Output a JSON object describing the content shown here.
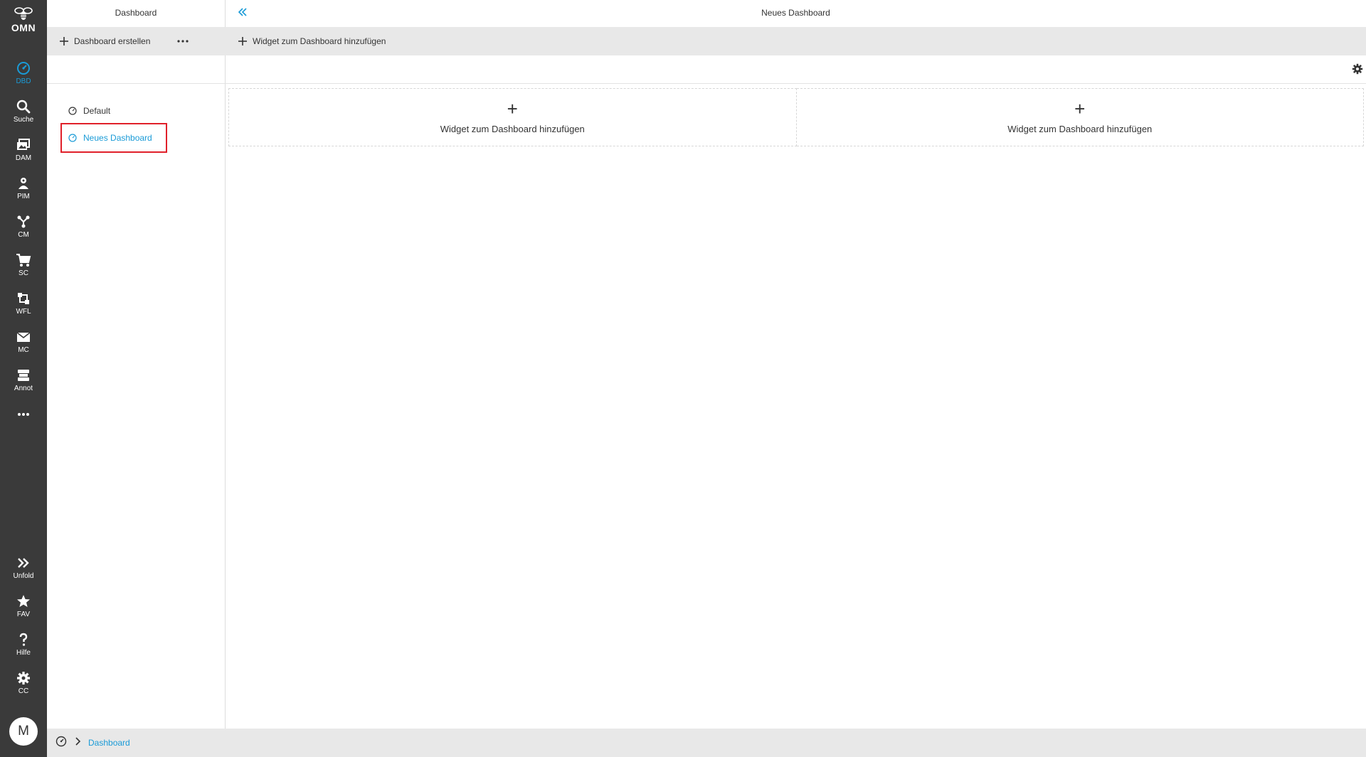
{
  "colors": {
    "accent": "#1a9bd7",
    "rail": "#3a3a3a",
    "highlight": "#e0202a",
    "toolbar": "#e8e8e8"
  },
  "logo": {
    "text": "OMN",
    "icon": "bee-icon"
  },
  "rail": {
    "items": [
      {
        "label": "DBD",
        "icon": "dashboard-gauge-icon",
        "active": true
      },
      {
        "label": "Suche",
        "icon": "search-icon"
      },
      {
        "label": "DAM",
        "icon": "images-icon"
      },
      {
        "label": "PIM",
        "icon": "product-icon"
      },
      {
        "label": "CM",
        "icon": "network-icon"
      },
      {
        "label": "SC",
        "icon": "cart-icon"
      },
      {
        "label": "WFL",
        "icon": "workflow-icon"
      },
      {
        "label": "MC",
        "icon": "envelope-icon"
      },
      {
        "label": "Annot",
        "icon": "annotation-icon"
      },
      {
        "label": "",
        "icon": "more-icon"
      }
    ],
    "bottom": [
      {
        "label": "Unfold",
        "icon": "double-chevron-right-icon"
      },
      {
        "label": "FAV",
        "icon": "star-icon"
      },
      {
        "label": "Hilfe",
        "icon": "question-icon"
      },
      {
        "label": "CC",
        "icon": "gear-icon"
      }
    ],
    "avatar": "M"
  },
  "left_panel": {
    "title": "Dashboard",
    "create_label": "Dashboard erstellen",
    "more_icon": "more-icon",
    "dashboards": [
      {
        "label": "Default",
        "active": false
      },
      {
        "label": "Neues Dashboard",
        "active": true
      }
    ]
  },
  "main": {
    "title": "Neues Dashboard",
    "add_widget_label": "Widget zum Dashboard hinzufügen",
    "widget_slots": [
      {
        "plus": "+",
        "label": "Widget zum Dashboard hinzufügen"
      },
      {
        "plus": "+",
        "label": "Widget zum Dashboard hinzufügen"
      }
    ]
  },
  "footer": {
    "breadcrumb": "Dashboard"
  }
}
